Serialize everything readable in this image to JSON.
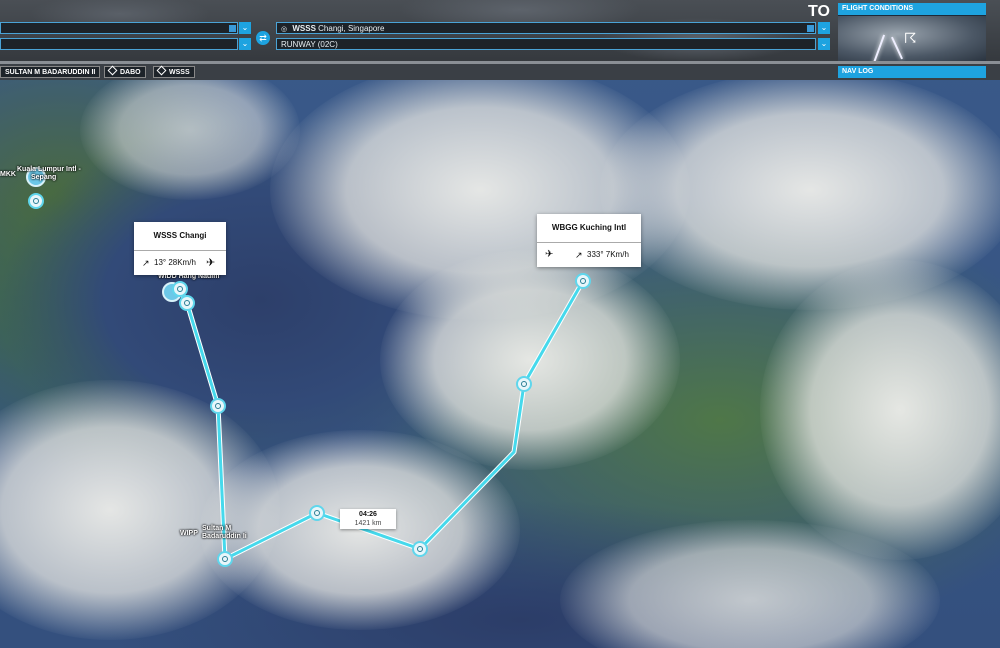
{
  "header": {
    "to_label": "TO",
    "departure": {
      "airport_value": "",
      "runway_value": ""
    },
    "arrival": {
      "icao": "WSSS",
      "name": "Changi, Singapore",
      "runway_value": "RUNWAY (02C)"
    },
    "swap_icon": "swap-arrows-icon",
    "flight_conditions_label": "FLIGHT CONDITIONS"
  },
  "waypoint_bar": {
    "items": [
      "SULTAN M BADARUDDIN II",
      "DABO",
      "WSSS"
    ],
    "nav_log_label": "NAV LOG"
  },
  "map": {
    "labels": {
      "wmkk_icao": "MKK",
      "wmkk_name_1": "Kuala Lumpur Intl -",
      "wmkk_name_2": "Sepang",
      "wido_name": "WIDD  Hang Nadim",
      "wipp_icao": "WIPP",
      "wipp_name_1": "Sultan M",
      "wipp_name_2": "Badaruddin Ii"
    },
    "departure_card": {
      "title": "WSSS  Changi",
      "wind": "13° 28Km/h",
      "wind_icon": "wind-sock-icon",
      "landing_icon": "landing-icon"
    },
    "arrival_card": {
      "title": "WBGG  Kuching Intl",
      "wind": "333° 7Km/h",
      "wind_icon": "wind-sock-icon",
      "takeoff_icon": "takeoff-icon"
    },
    "leg_info": {
      "time": "04:26",
      "distance": "1421 km"
    },
    "route_color": "#46d9ec"
  }
}
